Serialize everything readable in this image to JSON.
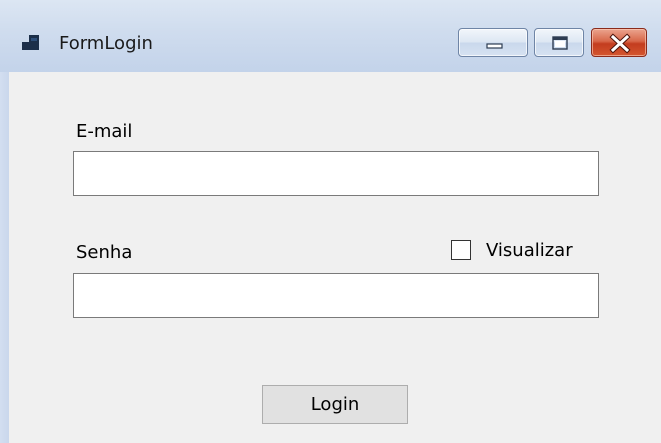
{
  "window": {
    "title": "FormLogin",
    "icon": "app-window-icon",
    "controls": {
      "minimize_icon": "minimize-icon",
      "maximize_icon": "maximize-icon",
      "close_icon": "close-icon",
      "close_color": "#c94a2b"
    }
  },
  "form": {
    "email_label": "E-mail",
    "email_value": "",
    "senha_label": "Senha",
    "senha_value": "",
    "visualizar_label": "Visualizar",
    "visualizar_checked": false,
    "login_label": "Login"
  }
}
